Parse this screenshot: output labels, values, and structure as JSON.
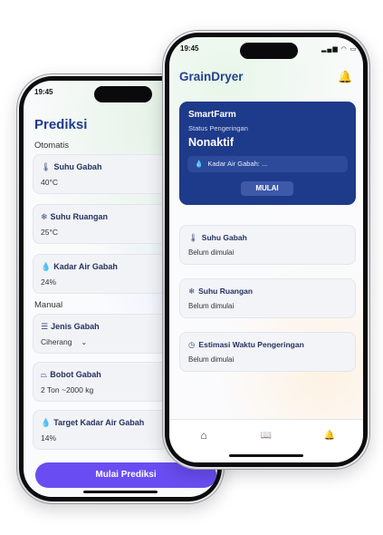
{
  "back_phone": {
    "status_time": "19:45",
    "title": "Prediksi",
    "section_auto": "Otomatis",
    "section_manual": "Manual",
    "auto_fields": [
      {
        "icon": "thermometer-icon",
        "glyph": "🌡",
        "label": "Suhu Gabah",
        "value": "40°C"
      },
      {
        "icon": "snowflake-icon",
        "glyph": "❄",
        "label": "Suhu Ruangan",
        "value": "25°C"
      },
      {
        "icon": "droplet-icon",
        "glyph": "💧",
        "label": "Kadar Air Gabah",
        "value": "24%"
      }
    ],
    "manual_fields": [
      {
        "icon": "list-icon",
        "glyph": "☰",
        "label": "Jenis Gabah",
        "value": "Ciherang"
      },
      {
        "icon": "weight-icon",
        "glyph": "⏢",
        "label": "Bobot Gabah",
        "value": "2 Ton ~2000 kg"
      },
      {
        "icon": "droplet-icon",
        "glyph": "💧",
        "label": "Target Kadar Air Gabah",
        "value": "14%"
      }
    ],
    "dropdown_chevron": "⌄",
    "cta_label": "Mulai Prediksi"
  },
  "front_phone": {
    "status_time": "19:45",
    "status_icons": "▂▄▆ ◠ ▭",
    "app_title": "GrainDryer",
    "hero": {
      "brand": "SmartFarm",
      "status_label": "Status Pengeringan",
      "status_value": "Nonaktif",
      "moisture_text": "Kadar Air Gabah: ...",
      "start_label": "MULAI"
    },
    "cards": [
      {
        "icon": "thermometer-icon",
        "glyph": "🌡",
        "label": "Suhu Gabah",
        "value": "Belum dimulai"
      },
      {
        "icon": "snowflake-icon",
        "glyph": "❄",
        "label": "Suhu Ruangan",
        "value": "Belum dimulai"
      },
      {
        "icon": "clock-icon",
        "glyph": "◷",
        "label": "Estimasi Waktu Pengeringan",
        "value": "Belum dimulai"
      }
    ],
    "tabs": [
      {
        "icon": "home-icon",
        "glyph": "⌂"
      },
      {
        "icon": "book-icon",
        "glyph": "📖"
      },
      {
        "icon": "bell-icon",
        "glyph": "🔔"
      }
    ]
  },
  "colors": {
    "primary_blue": "#1e3a8a",
    "cta_purple": "#6a4df2",
    "card_bg": "#f3f4f8"
  }
}
